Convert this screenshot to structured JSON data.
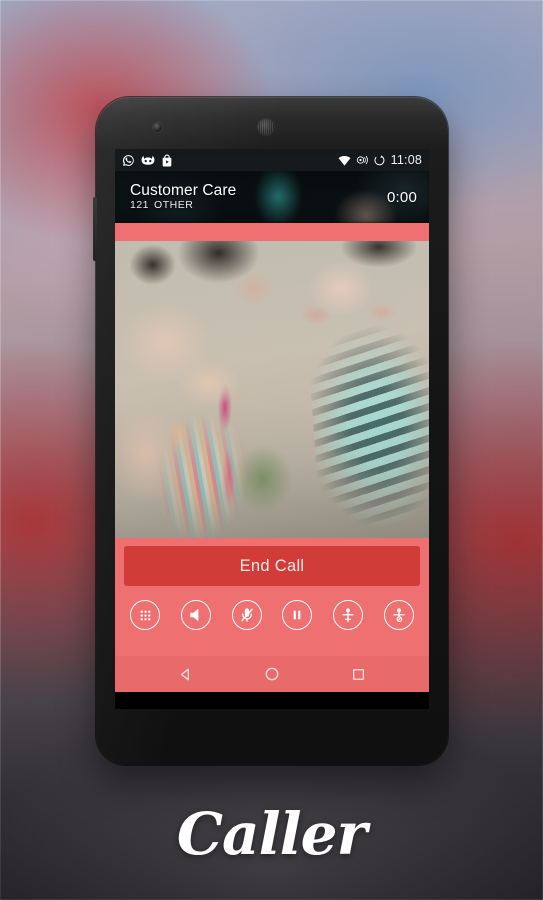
{
  "brand": {
    "name": "Caller"
  },
  "status_bar": {
    "left_icons": [
      {
        "name": "whatsapp-icon",
        "label": "WhatsApp"
      },
      {
        "name": "cyanogenmod-icon",
        "label": "CyanogenMod"
      },
      {
        "name": "play-store-bag-icon",
        "label": "Play Store"
      }
    ],
    "right_icons": [
      {
        "name": "wifi-icon",
        "label": "Wi-Fi"
      },
      {
        "name": "vibrate-icon",
        "label": "Vibrate"
      },
      {
        "name": "sync-icon",
        "label": "Sync"
      }
    ],
    "time": "11:08"
  },
  "call": {
    "contact_name": "Customer Care",
    "number": "121",
    "number_type": "OTHER",
    "duration": "0:00"
  },
  "controls": {
    "end_call_label": "End Call",
    "buttons": [
      {
        "name": "dialpad-button",
        "icon": "dialpad-icon",
        "label": "Dialpad"
      },
      {
        "name": "speaker-button",
        "icon": "speaker-icon",
        "label": "Speaker"
      },
      {
        "name": "mute-button",
        "icon": "mic-muted-icon",
        "label": "Mute"
      },
      {
        "name": "hold-button",
        "icon": "pause-icon",
        "label": "Hold"
      },
      {
        "name": "add-call-button",
        "icon": "person-add-icon",
        "label": "Add call"
      },
      {
        "name": "block-call-button",
        "icon": "person-block-icon",
        "label": "Block"
      }
    ]
  },
  "nav_bar": {
    "buttons": [
      {
        "name": "nav-back-button",
        "icon": "triangle-back-icon",
        "label": "Back"
      },
      {
        "name": "nav-home-button",
        "icon": "circle-home-icon",
        "label": "Home"
      },
      {
        "name": "nav-recents-button",
        "icon": "square-recents-icon",
        "label": "Recents"
      }
    ]
  },
  "colors": {
    "accent_coral": "#ee7070",
    "end_call_red": "#d03c38",
    "nav_bar": "#e96a6a",
    "status_bar_dark": "#16191b"
  }
}
